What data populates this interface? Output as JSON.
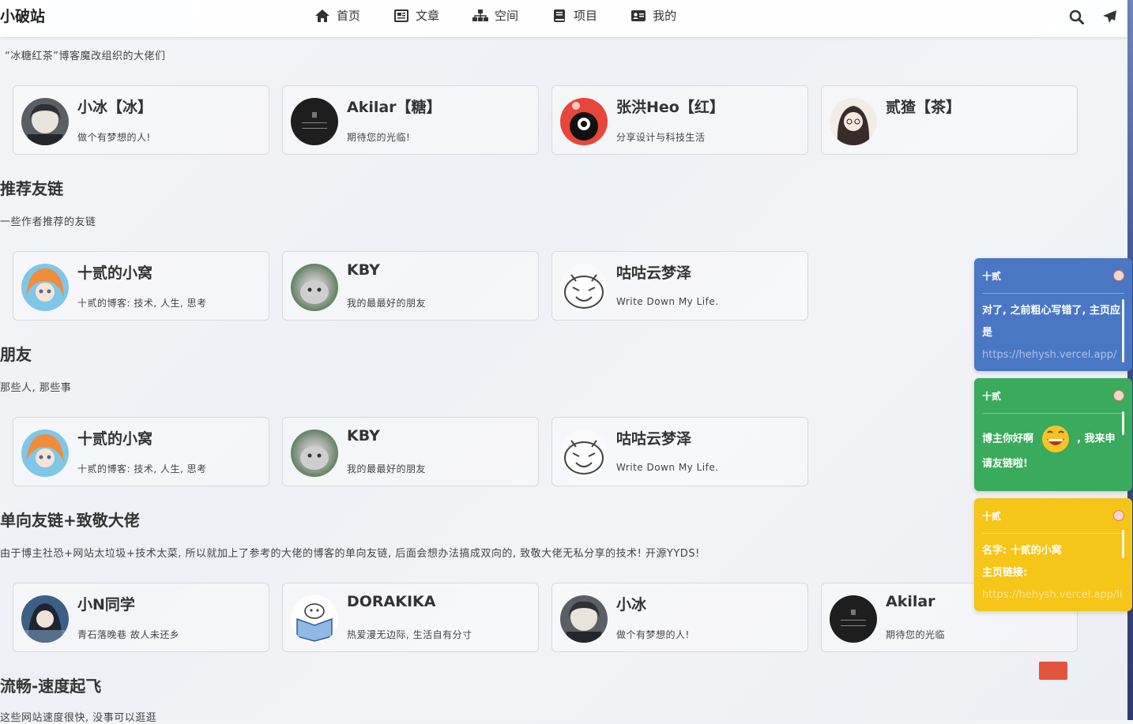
{
  "header": {
    "site_title": "小破站",
    "nav": [
      {
        "label": "首页",
        "icon": "home-icon"
      },
      {
        "label": "文章",
        "icon": "article-icon"
      },
      {
        "label": "空间",
        "icon": "sitemap-icon"
      },
      {
        "label": "项目",
        "icon": "book-icon"
      },
      {
        "label": "我的",
        "icon": "id-card-icon"
      }
    ],
    "tools": [
      "search-icon",
      "send-icon"
    ]
  },
  "section0": {
    "desc": "“冰糖红茶”博客魔改组织的大佬们",
    "cards": [
      {
        "name": "小冰【冰】",
        "desc": "做个有梦想的人!"
      },
      {
        "name": "Akilar【糖】",
        "desc": "期待您的光临!"
      },
      {
        "name": "张洪Heo【红】",
        "desc": "分享设计与科技生活"
      },
      {
        "name": "贰猹【茶】",
        "desc": ""
      }
    ]
  },
  "section1": {
    "title": "推荐友链",
    "desc": "一些作者推荐的友链",
    "cards": [
      {
        "name": "十贰的小窝",
        "desc": "十贰的博客: 技术, 人生, 思考"
      },
      {
        "name": "KBY",
        "desc": "我的最最好的朋友"
      },
      {
        "name": "咕咕云梦泽",
        "desc": "Write Down My Life."
      }
    ]
  },
  "section2": {
    "title": "朋友",
    "desc": "那些人, 那些事",
    "cards": [
      {
        "name": "十贰的小窝",
        "desc": "十贰的博客: 技术, 人生, 思考"
      },
      {
        "name": "KBY",
        "desc": "我的最最好的朋友"
      },
      {
        "name": "咕咕云梦泽",
        "desc": "Write Down My Life."
      }
    ]
  },
  "section3": {
    "title": "单向友链+致敬大佬",
    "desc": "由于博主社恐+网站太垃圾+技术太菜, 所以就加上了参考的大佬的博客的单向友链, 后面会想办法搞成双向的, 致敬大佬无私分享的技术! 开源YYDS!",
    "cards": [
      {
        "name": "小N同学",
        "desc": "青石落晚巷 故人未还乡"
      },
      {
        "name": "DORAKIKA",
        "desc": "热爱漫无边际, 生活自有分寸"
      },
      {
        "name": "小冰",
        "desc": "做个有梦想的人!"
      },
      {
        "name": "Akilar",
        "desc": "期待您的光临"
      }
    ]
  },
  "section4": {
    "title": "流畅-速度起飞",
    "desc": "这些网站速度很快, 没事可以逛逛"
  },
  "notifications": [
    {
      "author": "十贰",
      "text": "对了, 之前粗心写错了, 主页应是",
      "link": "https://hehysh.vercel.app/",
      "color": "#4a77c4"
    },
    {
      "author": "十贰",
      "text_before": "博主你好啊",
      "text_after": ", 我来申请友链啦!",
      "color": "#3aaa5c"
    },
    {
      "author": "十贰",
      "line1": "名字: 十贰的小窝",
      "line2": "主页链接:",
      "link": "https://hehysh.vercel.app/li",
      "color": "#f5c518"
    }
  ]
}
